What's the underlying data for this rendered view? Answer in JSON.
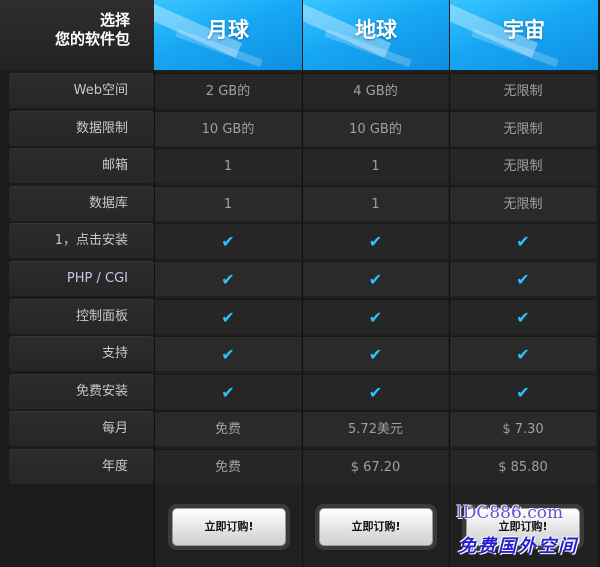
{
  "corner": {
    "line1": "选择",
    "line2": "您的软件包"
  },
  "plans": [
    {
      "name": "月球",
      "order_label": "立即订购!"
    },
    {
      "name": "地球",
      "order_label": "立即订购!"
    },
    {
      "name": "宇宙",
      "order_label": "立即订购!"
    }
  ],
  "rows": [
    {
      "label": "Web空间",
      "values": [
        "2 GB的",
        "4 GB的",
        "无限制"
      ]
    },
    {
      "label": "数据限制",
      "values": [
        "10 GB的",
        "10 GB的",
        "无限制"
      ]
    },
    {
      "label": "邮箱",
      "values": [
        "1",
        "1",
        "无限制"
      ]
    },
    {
      "label": "数据库",
      "values": [
        "1",
        "1",
        "无限制"
      ]
    },
    {
      "label": "1，点击安装",
      "values": [
        "✔",
        "✔",
        "✔"
      ]
    },
    {
      "label": "PHP / CGI",
      "values": [
        "✔",
        "✔",
        "✔"
      ]
    },
    {
      "label": "控制面板",
      "values": [
        "✔",
        "✔",
        "✔"
      ]
    },
    {
      "label": "支持",
      "values": [
        "✔",
        "✔",
        "✔"
      ]
    },
    {
      "label": "免费安装",
      "values": [
        "✔",
        "✔",
        "✔"
      ]
    },
    {
      "label": "每月",
      "values": [
        "免费",
        "5.72美元",
        "$ 7.30"
      ]
    },
    {
      "label": "年度",
      "values": [
        "免费",
        "$ 67.20",
        "$ 85.80"
      ]
    }
  ],
  "watermark": {
    "line1": "IDC886.com",
    "line2": "免费国外空间"
  },
  "colors": {
    "accent": "#1aa9f2",
    "check": "#2bc4ff",
    "background": "#1b1b1b"
  }
}
